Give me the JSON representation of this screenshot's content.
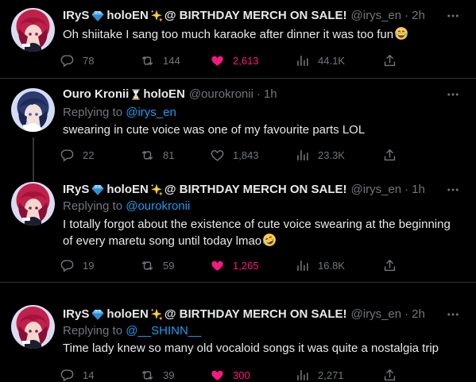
{
  "tweets": [
    {
      "name": "IRyS",
      "name_suffix": "holoEN",
      "name_tail": "@ BIRTHDAY MERCH ON SALE!",
      "handle": "@irys_en",
      "time": "2h",
      "text": "Oh shiitake I sang too much karaoke after dinner it was too fun",
      "replies": "78",
      "retweets": "144",
      "likes": "2,613",
      "views": "44.1K"
    },
    {
      "name": "Ouro Kronii",
      "name_suffix": "holoEN",
      "handle": "@ourokronii",
      "time": "1h",
      "replying_prefix": "Replying to",
      "replying_to": "@irys_en",
      "text": "swearing in cute voice was one of my favourite parts LOL",
      "replies": "22",
      "retweets": "81",
      "likes": "1,843",
      "views": "23.3K"
    },
    {
      "name": "IRyS",
      "name_suffix": "holoEN",
      "name_tail": "@ BIRTHDAY MERCH ON SALE!",
      "handle": "@irys_en",
      "time": "1h",
      "replying_prefix": "Replying to",
      "replying_to": "@ourokronii",
      "text": "I totally forgot about the existence of cute voice swearing at the beginning of every maretu song until today lmao",
      "replies": "19",
      "retweets": "59",
      "likes": "1,265",
      "views": "16.8K"
    },
    {
      "name": "IRyS",
      "name_suffix": "holoEN",
      "name_tail": "@ BIRTHDAY MERCH ON SALE!",
      "handle": "@irys_en",
      "time": "2h",
      "replying_prefix": "Replying to",
      "replying_to": "@__SHINN__",
      "text": "Time lady knew so many old vocaloid songs it was quite a nostalgia trip",
      "replies": "14",
      "retweets": "39",
      "likes": "300",
      "views": "2,271"
    }
  ],
  "colors": {
    "background": "#000000",
    "text": "#e7e9ea",
    "muted": "#71767b",
    "link": "#1d9bf0",
    "like_active": "#f91880",
    "divider": "#2f3336"
  },
  "icons": [
    "reply-icon",
    "retweet-icon",
    "heart-icon",
    "views-icon",
    "share-icon",
    "more-icon",
    "gem-emoji",
    "sparkles-emoji",
    "hourglass-emoji",
    "laughing-emoji",
    "rofl-emoji"
  ]
}
